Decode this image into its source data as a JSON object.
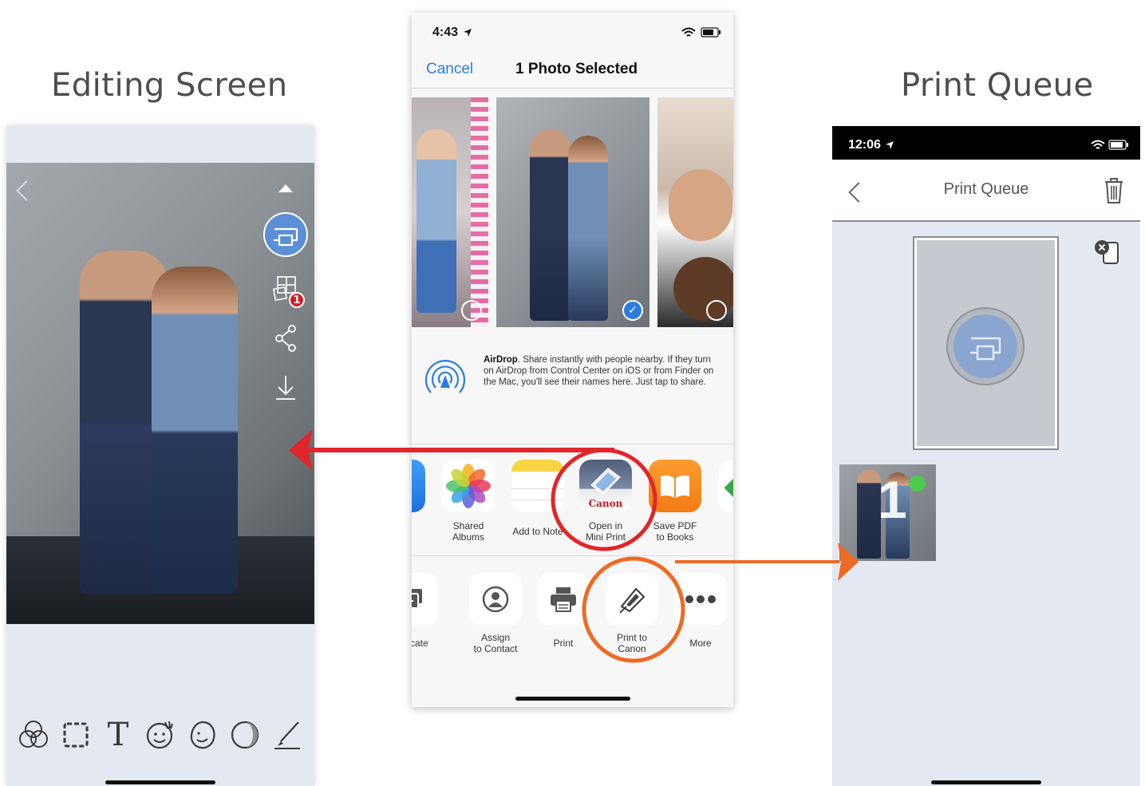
{
  "captions": {
    "editing": "Editing Screen",
    "queue": "Print Queue"
  },
  "colors": {
    "accent_blue": "#5c8fd6",
    "ios_blue": "#2d7de0",
    "highlight_red": "#e0262a",
    "highlight_orange": "#ef6a24",
    "badge_red": "#d21f26"
  },
  "editing_screen": {
    "icons": [
      "back-icon",
      "collapse-icon",
      "print-icon",
      "collage-icon",
      "share-icon",
      "download-icon"
    ],
    "collage_badge": "1",
    "tools": [
      "filter-icon",
      "frame-icon",
      "text-icon",
      "sticker-icon",
      "beautify-icon",
      "adjust-icon",
      "draw-icon"
    ]
  },
  "share_sheet": {
    "status_time": "4:43",
    "cancel_label": "Cancel",
    "title": "1 Photo Selected",
    "airdrop": {
      "heading": "AirDrop",
      "body": ". Share instantly with people nearby. If they turn on AirDrop from Control Center on iOS or from Finder on the Mac, you'll see their names here. Just tap to share."
    },
    "apps": [
      {
        "label_1": "Shared",
        "label_2": "Albums"
      },
      {
        "label_1": "Add to Note",
        "label_2": ""
      },
      {
        "label_1": "Open in",
        "label_2": "Mini Print",
        "brand": "Canon"
      },
      {
        "label_1": "Save PDF",
        "label_2": "to Books"
      }
    ],
    "actions": [
      {
        "label_1": "uplicate",
        "label_2": ""
      },
      {
        "label_1": "Assign",
        "label_2": "to Contact"
      },
      {
        "label_1": "Print",
        "label_2": ""
      },
      {
        "label_1": "Print to",
        "label_2": "Canon"
      },
      {
        "label_1": "More",
        "label_2": ""
      }
    ]
  },
  "print_queue": {
    "status_time": "12:06",
    "title": "Print Queue",
    "queue_item_number": "1"
  }
}
